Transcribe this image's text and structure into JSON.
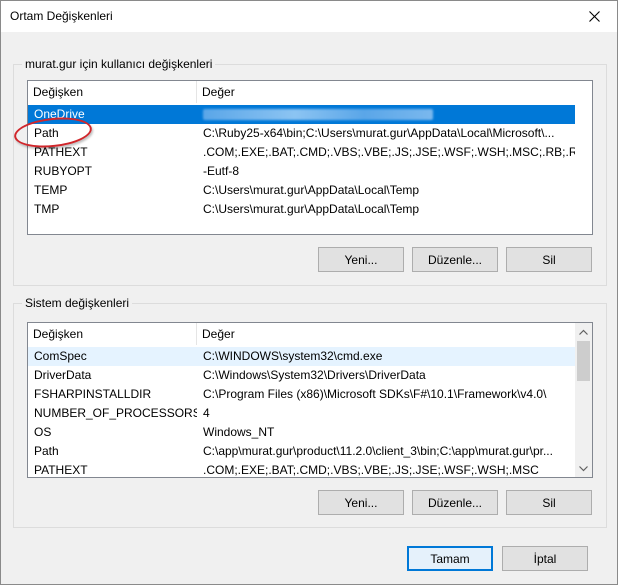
{
  "window": {
    "title": "Ortam Değişkenleri"
  },
  "user_group": {
    "label": "murat.gur için kullanıcı değişkenleri",
    "columns": [
      "Değişken",
      "Değer"
    ],
    "rows": [
      {
        "name": "OneDrive",
        "value": ""
      },
      {
        "name": "Path",
        "value": "C:\\Ruby25-x64\\bin;C:\\Users\\murat.gur\\AppData\\Local\\Microsoft\\..."
      },
      {
        "name": "PATHEXT",
        "value": ".COM;.EXE;.BAT;.CMD;.VBS;.VBE;.JS;.JSE;.WSF;.WSH;.MSC;.RB;.RBW;..."
      },
      {
        "name": "RUBYOPT",
        "value": "-Eutf-8"
      },
      {
        "name": "TEMP",
        "value": "C:\\Users\\murat.gur\\AppData\\Local\\Temp"
      },
      {
        "name": "TMP",
        "value": "C:\\Users\\murat.gur\\AppData\\Local\\Temp"
      }
    ],
    "buttons": {
      "new": "Yeni...",
      "edit": "Düzenle...",
      "delete": "Sil"
    }
  },
  "system_group": {
    "label": "Sistem değişkenleri",
    "columns": [
      "Değişken",
      "Değer"
    ],
    "rows": [
      {
        "name": "ComSpec",
        "value": "C:\\WINDOWS\\system32\\cmd.exe"
      },
      {
        "name": "DriverData",
        "value": "C:\\Windows\\System32\\Drivers\\DriverData"
      },
      {
        "name": "FSHARPINSTALLDIR",
        "value": "C:\\Program Files (x86)\\Microsoft SDKs\\F#\\10.1\\Framework\\v4.0\\"
      },
      {
        "name": "NUMBER_OF_PROCESSORS",
        "value": "4"
      },
      {
        "name": "OS",
        "value": "Windows_NT"
      },
      {
        "name": "Path",
        "value": "C:\\app\\murat.gur\\product\\11.2.0\\client_3\\bin;C:\\app\\murat.gur\\pr..."
      },
      {
        "name": "PATHEXT",
        "value": ".COM;.EXE;.BAT;.CMD;.VBS;.VBE;.JS;.JSE;.WSF;.WSH;.MSC"
      }
    ],
    "buttons": {
      "new": "Yeni...",
      "edit": "Düzenle...",
      "delete": "Sil"
    }
  },
  "footer": {
    "ok": "Tamam",
    "cancel": "İptal"
  },
  "colors": {
    "selection": "#0078d7",
    "hover": "#e5f3ff",
    "annotation": "#d0262b"
  },
  "icons": {
    "close": "close-icon",
    "scroll_up": "chevron-up-icon",
    "scroll_down": "chevron-down-icon"
  }
}
